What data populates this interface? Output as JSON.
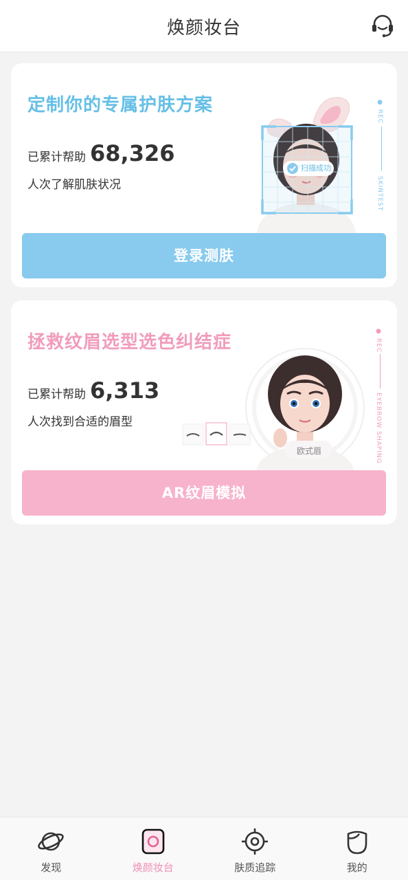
{
  "header": {
    "title": "焕颜妆台",
    "support_icon": "headset-icon"
  },
  "cards": [
    {
      "title": "定制你的专属护肤方案",
      "stat_prefix": "已累计帮助",
      "stat_value": "68,326",
      "stat_suffix": "人次了解肌肤状况",
      "button_label": "登录测肤",
      "scan_badge": "扫描成功",
      "tag_top": "REC",
      "tag_bottom": "SKINTEST",
      "accent": "#66bfe6"
    },
    {
      "title": "拯救纹眉选型选色纠结症",
      "stat_prefix": "已累计帮助",
      "stat_value": "6,313",
      "stat_suffix": "人次找到合适的眉型",
      "button_label": "AR纹眉模拟",
      "brow_badge": "欧式眉",
      "tag_top": "REC",
      "tag_bottom": "EYEBROW SHAPING",
      "accent": "#f19cbc"
    }
  ],
  "tabs": [
    {
      "label": "发现",
      "icon": "planet-icon",
      "active": false
    },
    {
      "label": "焕颜妆台",
      "icon": "camera-icon",
      "active": true
    },
    {
      "label": "肤质追踪",
      "icon": "target-icon",
      "active": false
    },
    {
      "label": "我的",
      "icon": "face-icon",
      "active": false
    }
  ]
}
